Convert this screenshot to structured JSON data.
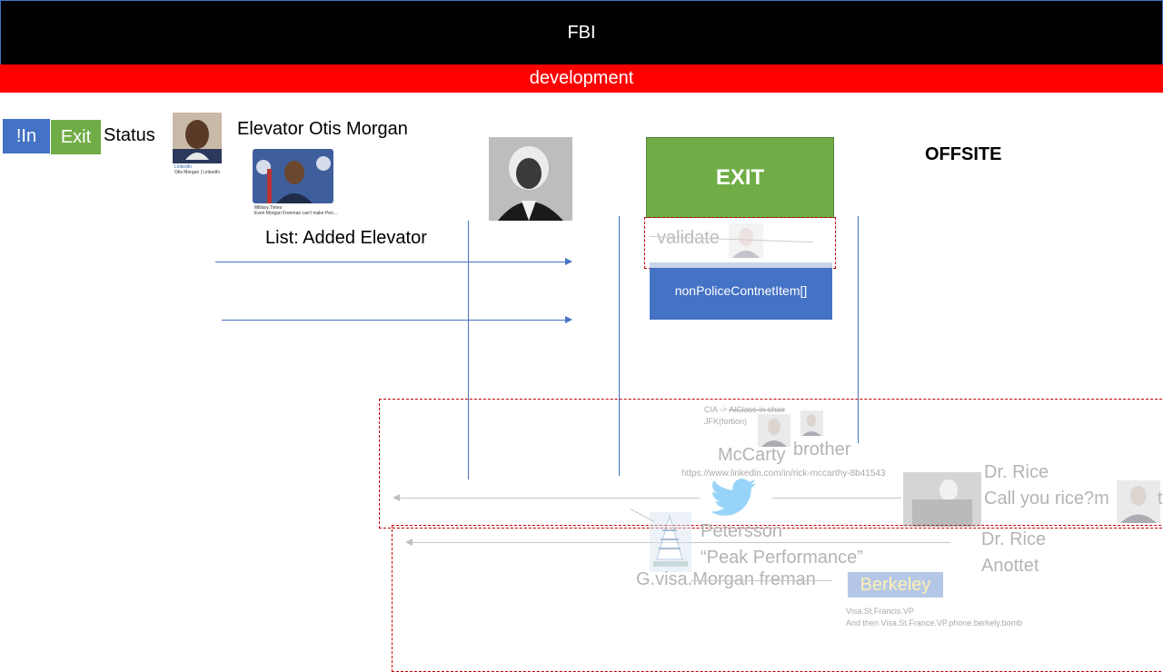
{
  "header": {
    "title": "FBI"
  },
  "env_banner": "development",
  "controls": {
    "in_label": "!In",
    "exit_label": "Exit",
    "status_label": "Status"
  },
  "person": {
    "title_prefix": "Elevator",
    "name": "Otis Morgan",
    "linkedin_source": "LinkedIn",
    "linkedin_caption": "Otis Morgan | LinkedIn",
    "military_source": "Military.Times",
    "military_caption": "Even Morgan Freeman can't make Pen..."
  },
  "list_label": "List: Added Elevator",
  "exit_box": "EXIT",
  "offsite_label": "OFFSITE",
  "validate_label": "validate",
  "np_label": "nonPoliceContnetItem[]",
  "faint": {
    "cia_line_a": "CIA -> ",
    "cia_line_b": "AlClass in chair",
    "cia_line_c": "JFK(fortion)",
    "mccarty": "McCarty",
    "brother": "brother",
    "linkedin_url": "https://www.linkedin.com/in/rick-mccarthy-8b41543",
    "dr_rice": "Dr. Rice",
    "call_rice": "Call you rice?m",
    "call_rice_tail": "t",
    "petersson": "Petersson",
    "peak": "“Peak Performance”",
    "visa_morgan": "G.visa.Morgan freman",
    "dr_rice_2": "Dr. Rice",
    "anottet": "Anottet",
    "berkeley": "Berkeley",
    "visa_1": "Visa.St.Francis.VP",
    "visa_2": "And then Visa.St.France.VP.phone.berkely.bomb"
  },
  "colors": {
    "header": "#000000",
    "banner": "#ff0000",
    "in": "#4472c4",
    "exit": "#70ad47",
    "np": "#4472c4",
    "dashed": "#c00000"
  },
  "icons": [
    "twitter-bird-icon"
  ]
}
